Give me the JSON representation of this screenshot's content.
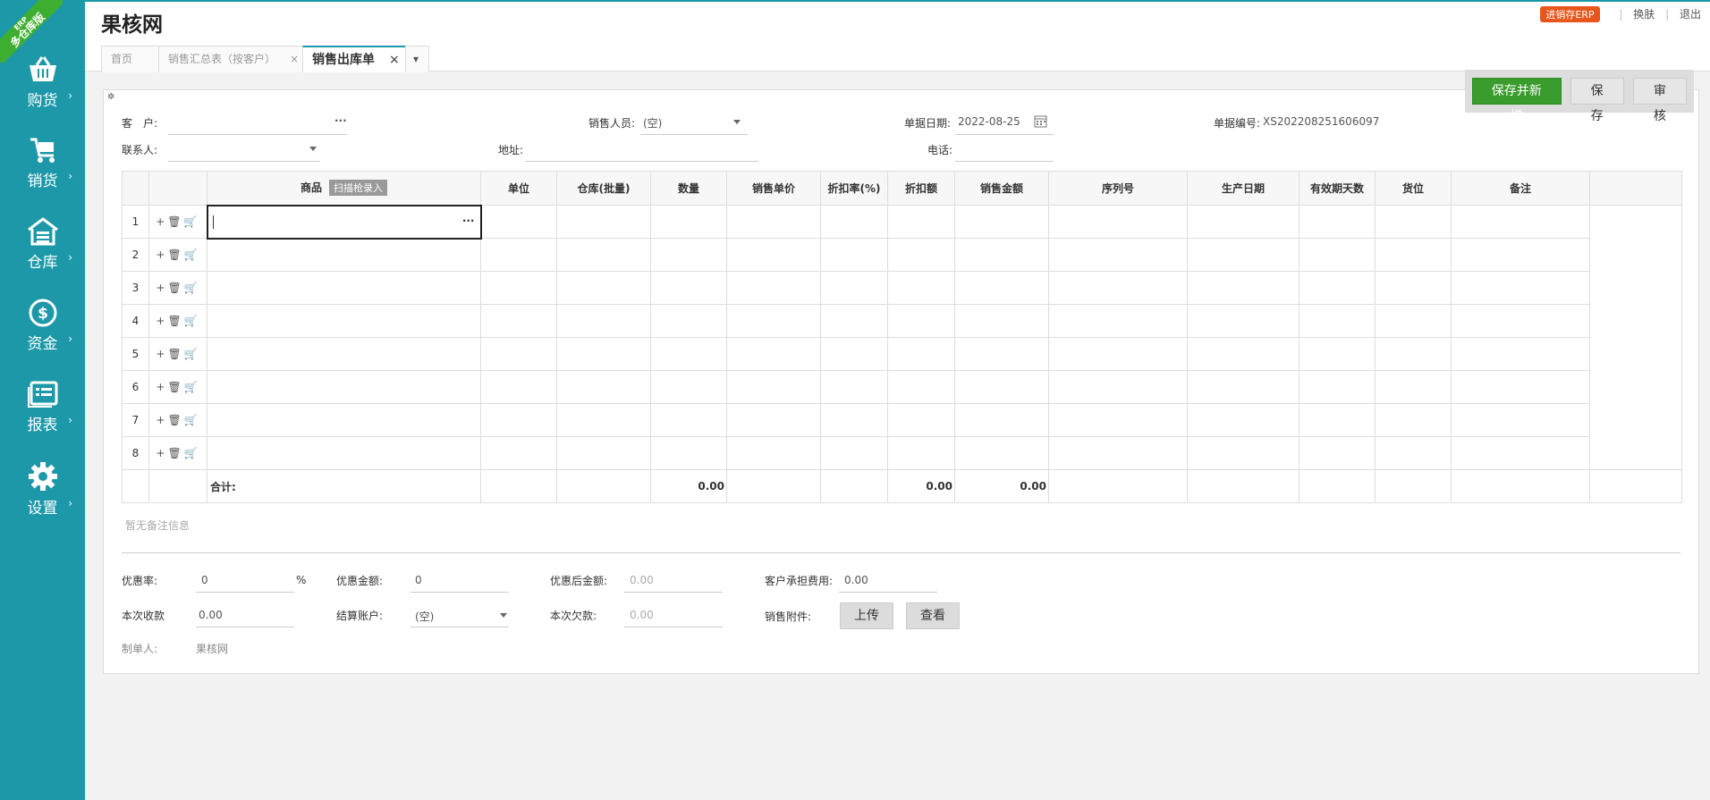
{
  "app": {
    "title": "果核网",
    "badge": "进销存ERP",
    "link_skin": "换肤",
    "link_logout": "退出",
    "ribbon_small": "ERP",
    "ribbon_text": "多仓库版"
  },
  "sidebar": {
    "items": [
      {
        "label": "购货",
        "icon": "basket-icon"
      },
      {
        "label": "销货",
        "icon": "cart-icon"
      },
      {
        "label": "仓库",
        "icon": "warehouse-icon"
      },
      {
        "label": "资金",
        "icon": "dollar-icon"
      },
      {
        "label": "报表",
        "icon": "report-icon"
      },
      {
        "label": "设置",
        "icon": "gear-icon"
      }
    ],
    "arrow": "›"
  },
  "tabs": [
    {
      "label": "首页"
    },
    {
      "label": "销售汇总表（按客户）",
      "close": "×"
    },
    {
      "label": "销售出库单",
      "close": "×"
    }
  ],
  "tab_menu": "▾",
  "actions": {
    "save_new": "保存并新增",
    "save": "保存",
    "audit": "审核"
  },
  "form": {
    "customer_label": "客　户:",
    "customer_dots": "···",
    "salesperson_label": "销售人员:",
    "salesperson_value": "(空)",
    "date_label": "单据日期:",
    "date_value": "2022-08-25",
    "docno_label": "单据编号:",
    "docno_value": "XS202208251606097",
    "contact_label": "联系人:",
    "address_label": "地址:",
    "phone_label": "电话:"
  },
  "grid": {
    "headers": [
      "商品",
      "单位",
      "仓库(批量)",
      "数量",
      "销售单价",
      "折扣率(%)",
      "折扣额",
      "销售金额",
      "序列号",
      "生产日期",
      "有效期天数",
      "货位",
      "备注"
    ],
    "scan_tag": "扫描枪录入",
    "row_ops": [
      "+",
      "🗑",
      "🛒"
    ],
    "rows": [
      "1",
      "2",
      "3",
      "4",
      "5",
      "6",
      "7",
      "8"
    ],
    "cell_dots": "···",
    "total_label": "合计:",
    "total_qty": "0.00",
    "total_discount": "0.00",
    "total_amount": "0.00"
  },
  "memo_placeholder": "暂无备注信息",
  "footer": {
    "discount_rate_label": "优惠率:",
    "discount_rate_value": "0",
    "percent": "%",
    "discount_amount_label": "优惠金额:",
    "discount_amount_value": "0",
    "after_discount_label": "优惠后金额:",
    "after_discount_value": "0.00",
    "customer_fee_label": "客户承担费用:",
    "customer_fee_value": "0.00",
    "received_label": "本次收款",
    "received_value": "0.00",
    "account_label": "结算账户:",
    "account_value": "(空)",
    "owed_label": "本次欠款:",
    "owed_value": "0.00",
    "attachment_label": "销售附件:",
    "upload": "上传",
    "view": "查看",
    "maker_label": "制单人:",
    "maker_value": "果核网"
  }
}
